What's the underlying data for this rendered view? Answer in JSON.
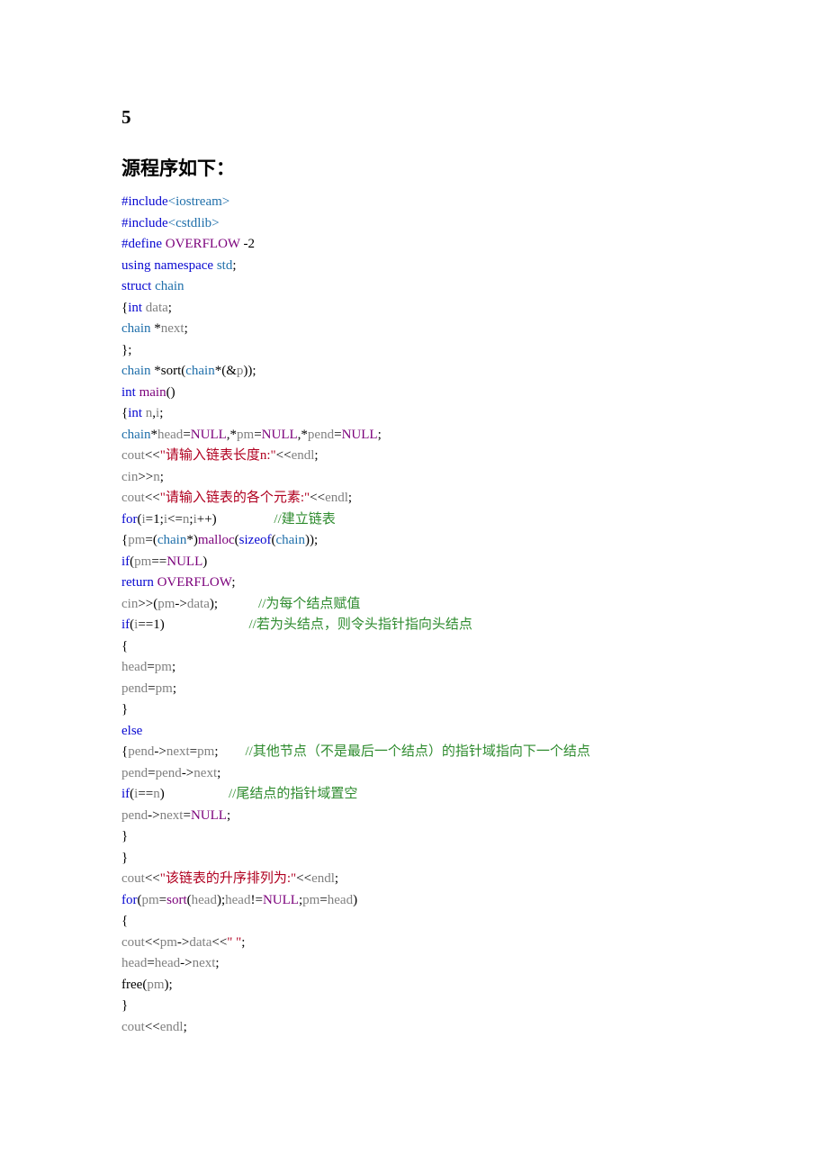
{
  "heading_num": "5",
  "heading_title": "源程序如下：",
  "lines": {
    "l01a": "#include",
    "l01b": "<iostream>",
    "l02a": "#include",
    "l02b": "<cstdlib>",
    "l03a": "#define ",
    "l03b": "OVERFLOW",
    "l03c": " -2",
    "l04a": "using",
    "l04b": " namespace",
    "l04c": " std",
    "l04d": ";",
    "l05a": "struct",
    "l05b": " chain",
    "l06a": "{",
    "l06b": "int",
    "l06c": " data",
    "l06d": ";",
    "l07a": "chain ",
    "l07b": "*",
    "l07c": "next",
    "l07d": ";",
    "l08a": "};",
    "l09a": "chain ",
    "l09b": "*",
    "l09c": "sort",
    "l09d": "(",
    "l09e": "chain",
    "l09f": "*(&",
    "l09g": "p",
    "l09h": "));",
    "l10a": "int",
    "l10b": " main",
    "l10c": "()",
    "l11a": "{",
    "l11b": "int",
    "l11c": " n",
    "l11d": ",",
    "l11e": "i",
    "l11f": ";",
    "l12a": "chain",
    "l12b": "*",
    "l12c": "head",
    "l12d": "=",
    "l12e": "NULL",
    "l12f": ",*",
    "l12g": "pm",
    "l12h": "=",
    "l12i": "NULL",
    "l12j": ",*",
    "l12k": "pend",
    "l12l": "=",
    "l12m": "NULL",
    "l12n": ";",
    "l13a": "cout",
    "l13b": "<<",
    "l13c": "\"请输入链表长度n:\"",
    "l13d": "<<",
    "l13e": "endl",
    "l13f": ";",
    "l14a": "cin",
    "l14b": ">>",
    "l14c": "n",
    "l14d": ";",
    "l15a": "cout",
    "l15b": "<<",
    "l15c": "\"请输入链表的各个元素:\"",
    "l15d": "<<",
    "l15e": "endl",
    "l15f": ";",
    "l16a": "for",
    "l16b": "(",
    "l16c": "i",
    "l16d": "=1;",
    "l16e": "i",
    "l16f": "<=",
    "l16g": "n",
    "l16h": ";",
    "l16i": "i",
    "l16j": "++)                 ",
    "l16k": "//建立链表",
    "l17a": "{",
    "l17b": "pm",
    "l17c": "=(",
    "l17d": "chain",
    "l17e": "*)",
    "l17f": "malloc",
    "l17g": "(",
    "l17h": "sizeof",
    "l17i": "(",
    "l17j": "chain",
    "l17k": "));",
    "l18a": "if",
    "l18b": "(",
    "l18c": "pm",
    "l18d": "==",
    "l18e": "NULL",
    "l18f": ")",
    "l19a": "return",
    "l19b": " OVERFLOW",
    "l19c": ";",
    "l20a": "cin",
    "l20b": ">>(",
    "l20c": "pm",
    "l20d": "->",
    "l20e": "data",
    "l20f": ");            ",
    "l20g": "//为每个结点赋值",
    "l21a": "if",
    "l21b": "(",
    "l21c": "i",
    "l21d": "==1)                         ",
    "l21e": "//若为头结点，则令头指针指向头结点",
    "l22a": "{",
    "l23a": "head",
    "l23b": "=",
    "l23c": "pm",
    "l23d": ";",
    "l24a": "pend",
    "l24b": "=",
    "l24c": "pm",
    "l24d": ";",
    "l25a": "}",
    "l26a": "else",
    "l27a": "{",
    "l27b": "pend",
    "l27c": "->",
    "l27d": "next",
    "l27e": "=",
    "l27f": "pm",
    "l27g": ";        ",
    "l27h": "//其他节点（不是最后一个结点）的指针域指向下一个结点",
    "l28a": "pend",
    "l28b": "=",
    "l28c": "pend",
    "l28d": "->",
    "l28e": "next",
    "l28f": ";",
    "l29a": "if",
    "l29b": "(",
    "l29c": "i",
    "l29d": "==",
    "l29e": "n",
    "l29f": ")                   ",
    "l29g": "//尾结点的指针域置空",
    "l30a": "pend",
    "l30b": "->",
    "l30c": "next",
    "l30d": "=",
    "l30e": "NULL",
    "l30f": ";",
    "l31a": "}",
    "l32a": "}",
    "l33a": "cout",
    "l33b": "<<",
    "l33c": "\"该链表的升序排列为:\"",
    "l33d": "<<",
    "l33e": "endl",
    "l33f": ";",
    "l34a": "for",
    "l34b": "(",
    "l34c": "pm",
    "l34d": "=",
    "l34e": "sort",
    "l34f": "(",
    "l34g": "head",
    "l34h": ");",
    "l34i": "head",
    "l34j": "!=",
    "l34k": "NULL",
    "l34l": ";",
    "l34m": "pm",
    "l34n": "=",
    "l34o": "head",
    "l34p": ")",
    "l35a": "{",
    "l36a": "cout",
    "l36b": "<<",
    "l36c": "pm",
    "l36d": "->",
    "l36e": "data",
    "l36f": "<<",
    "l36g": "\" \"",
    "l36h": ";",
    "l37a": "head",
    "l37b": "=",
    "l37c": "head",
    "l37d": "->",
    "l37e": "next",
    "l37f": ";",
    "l38a": "free",
    "l38b": "(",
    "l38c": "pm",
    "l38d": ");",
    "l39a": "}",
    "l40a": "cout",
    "l40b": "<<",
    "l40c": "endl",
    "l40d": ";"
  }
}
